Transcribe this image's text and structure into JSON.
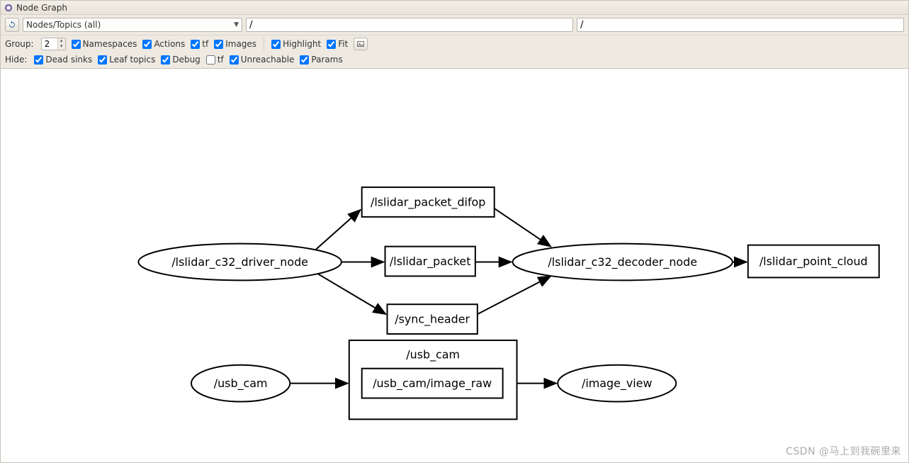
{
  "window": {
    "title": "Node Graph"
  },
  "toolbar": {
    "combo_label": "Nodes/Topics (all)",
    "filter1": "/",
    "filter2": "/"
  },
  "options": {
    "group_label": "Group:",
    "group_value": "2",
    "namespaces": "Namespaces",
    "actions": "Actions",
    "tf": "tf",
    "images": "Images",
    "highlight": "Highlight",
    "fit": "Fit"
  },
  "hide": {
    "label": "Hide:",
    "dead_sinks": "Dead sinks",
    "leaf_topics": "Leaf topics",
    "debug": "Debug",
    "tf": "tf",
    "unreachable": "Unreachable",
    "params": "Params"
  },
  "graph": {
    "nodes": {
      "driver": "/lslidar_c32_driver_node",
      "packet_difop": "/lslidar_packet_difop",
      "packet": "/lslidar_packet",
      "sync_header": "/sync_header",
      "decoder": "/lslidar_c32_decoder_node",
      "point_cloud": "/lslidar_point_cloud",
      "usb_cam_node": "/usb_cam",
      "usb_cam_ns": "/usb_cam",
      "image_raw": "/usb_cam/image_raw",
      "image_view": "/image_view"
    }
  },
  "watermark": "CSDN @马上到我碗里来"
}
